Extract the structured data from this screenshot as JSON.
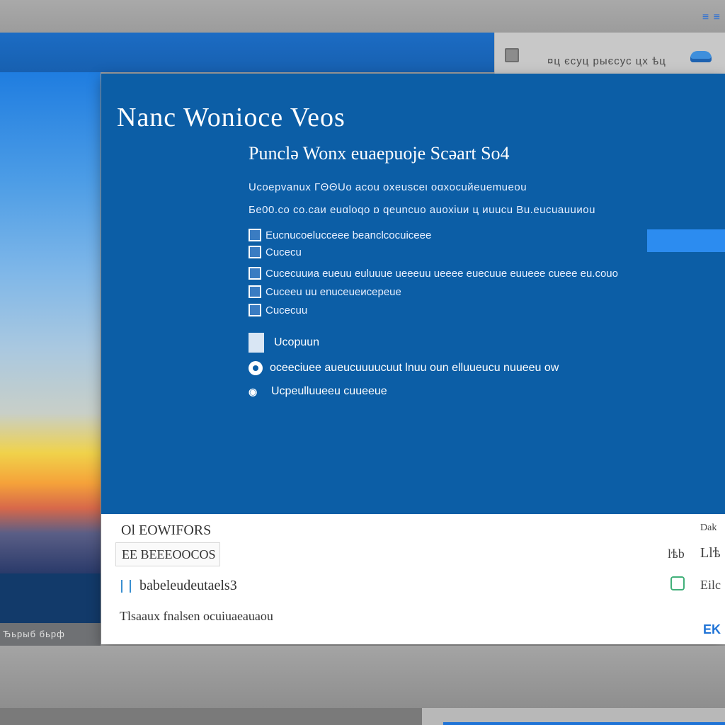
{
  "top_bar": {
    "corner_text": "≡ ≡"
  },
  "header_panel": {
    "label": "¤ц єсуц рыєсус цх ѣц"
  },
  "taskbar": {
    "label": "Ђьрыб бьрф"
  },
  "dialog": {
    "title": "Nanc Wonioce Veos",
    "subtitle": "Punclə Wonx euaepuoje Scəart  So4",
    "body_lines": [
      "Ucoepvanux ГΘΘUo acou oxeusceι oɑхocuйeuemueou",
      "Бe00.co co.caи euɑloqo ɒ qeuncuo auoxiuи ц иuuсu Вu.eucuauuиou"
    ],
    "list_items": [
      "Eucnucoelucceee beanclcocuiceee",
      "Cucecu",
      "Cucecuuиa eueuu euluuue ueeeuu ueeee euecuue euueee cueee eu.couo",
      "Cuceeu uu enuceueиcepeue",
      "Cucecuu"
    ],
    "options": [
      "Ucopuun",
      "oceeciuee aueucuuuucuut lnuu oun elluueucu nuueeu ow",
      "Ucpeulluueeu cuueeue"
    ]
  },
  "lower": {
    "heading": "Ol EOWIFORS",
    "field_value": "EE BEEEOOCOS",
    "row_label": "babeleudeutaels3",
    "footer": "Tlsaaux fnalsen ocuiuaeauaou",
    "right_top": "Dak",
    "right_mid_left": "lѣb",
    "right_mid_right": "Llѣ",
    "right_row_label": "Eilc",
    "right_link": "EK"
  }
}
